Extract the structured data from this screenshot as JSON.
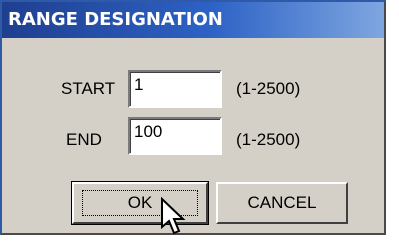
{
  "window": {
    "title": "RANGE DESIGNATION"
  },
  "form": {
    "start": {
      "label": "START",
      "value": "1",
      "range_hint": "(1-2500)"
    },
    "end": {
      "label": "END",
      "value": "100",
      "range_hint": "(1-2500)"
    }
  },
  "buttons": {
    "ok_label": "OK",
    "cancel_label": "CANCEL"
  },
  "colors": {
    "titlebar": "#2d62c6",
    "dialog_face": "#d4d0c8"
  },
  "icons": {
    "pointer": "arrow-cursor-icon"
  }
}
